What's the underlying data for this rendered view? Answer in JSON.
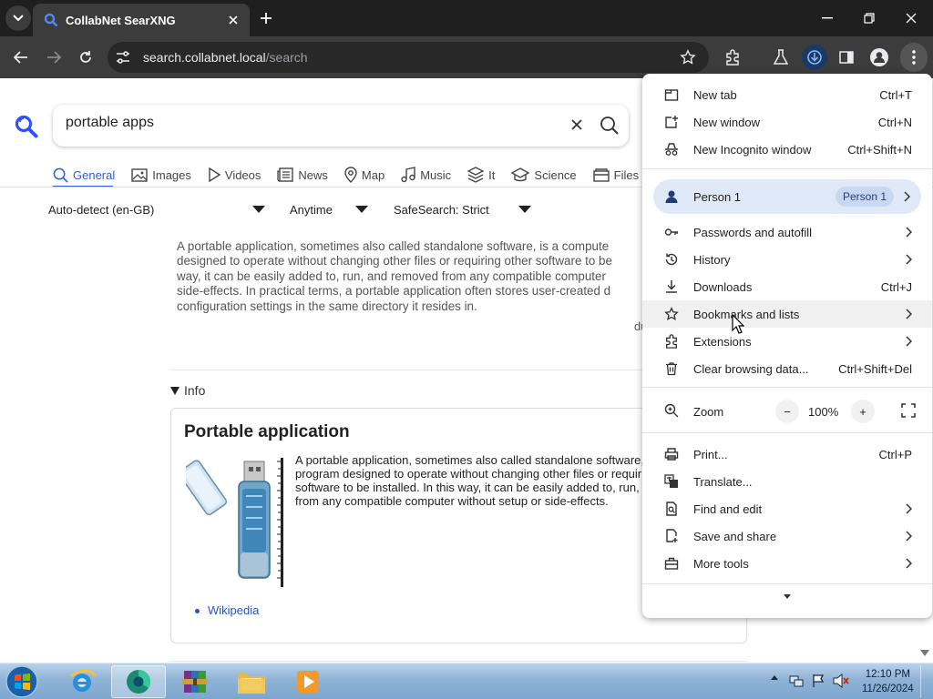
{
  "browser": {
    "tab_title": "CollabNet SearXNG",
    "url_host": "search.collabnet.local",
    "url_path": "/search"
  },
  "search": {
    "query": "portable apps",
    "categories": [
      {
        "label": "General",
        "icon": "search-icon",
        "active": true
      },
      {
        "label": "Images",
        "icon": "image-icon"
      },
      {
        "label": "Videos",
        "icon": "play-icon"
      },
      {
        "label": "News",
        "icon": "newspaper-icon"
      },
      {
        "label": "Map",
        "icon": "map-pin-icon"
      },
      {
        "label": "Music",
        "icon": "music-icon"
      },
      {
        "label": "It",
        "icon": "layers-icon"
      },
      {
        "label": "Science",
        "icon": "graduation-cap-icon"
      },
      {
        "label": "Files",
        "icon": "files-icon"
      }
    ],
    "filters": {
      "language": "Auto-detect (en-GB)",
      "time": "Anytime",
      "safesearch": "SafeSearch: Strict"
    }
  },
  "answer": {
    "lines": [
      "A portable application, sometimes also called standalone software, is a compute",
      "designed to operate without changing other files or requiring other software to be",
      "way, it can be easily added to, run, and removed from any compatible computer",
      "side-effects. In practical terms, a portable application often stores user-created d",
      "configuration settings in the same directory it resides in."
    ],
    "source_fragment": "du"
  },
  "infobox": {
    "toggle_label": "Info",
    "title": "Portable application",
    "text_lines": [
      "A portable application, sometimes also called standalone software,",
      "program designed to operate without changing other files or requiri",
      "software to be installed. In this way, it can be easily added to, run,",
      "from any compatible computer without setup or side-effects."
    ],
    "link": "Wikipedia"
  },
  "menu": {
    "items_top": [
      {
        "label": "New tab",
        "shortcut": "Ctrl+T",
        "icon": "new-tab-icon"
      },
      {
        "label": "New window",
        "shortcut": "Ctrl+N",
        "icon": "new-window-icon"
      },
      {
        "label": "New Incognito window",
        "shortcut": "Ctrl+Shift+N",
        "icon": "incognito-icon"
      }
    ],
    "person": {
      "label": "Person 1",
      "chip": "Person 1"
    },
    "items_mid": [
      {
        "label": "Passwords and autofill",
        "icon": "key-icon",
        "arrow": true
      },
      {
        "label": "History",
        "icon": "history-icon",
        "arrow": true
      },
      {
        "label": "Downloads",
        "shortcut": "Ctrl+J",
        "icon": "download-icon"
      },
      {
        "label": "Bookmarks and lists",
        "icon": "star-icon",
        "arrow": true
      },
      {
        "label": "Extensions",
        "icon": "puzzle-icon",
        "arrow": true
      },
      {
        "label": "Clear browsing data...",
        "shortcut": "Ctrl+Shift+Del",
        "icon": "trash-icon"
      }
    ],
    "zoom": {
      "label": "Zoom",
      "value": "100%",
      "minus": "−",
      "plus": "+"
    },
    "items_bottom": [
      {
        "label": "Print...",
        "shortcut": "Ctrl+P",
        "icon": "print-icon"
      },
      {
        "label": "Translate...",
        "icon": "translate-icon"
      },
      {
        "label": "Find and edit",
        "icon": "find-icon",
        "arrow": true
      },
      {
        "label": "Save and share",
        "icon": "save-share-icon",
        "arrow": true
      },
      {
        "label": "More tools",
        "icon": "toolbox-icon",
        "arrow": true
      }
    ]
  },
  "taskbar": {
    "time": "12:10 PM",
    "date": "11/26/2024"
  },
  "colors": {
    "accent": "#2b5fdc",
    "chrome_dark": "#1f1f1f",
    "toolbar": "#3c3c3c"
  }
}
